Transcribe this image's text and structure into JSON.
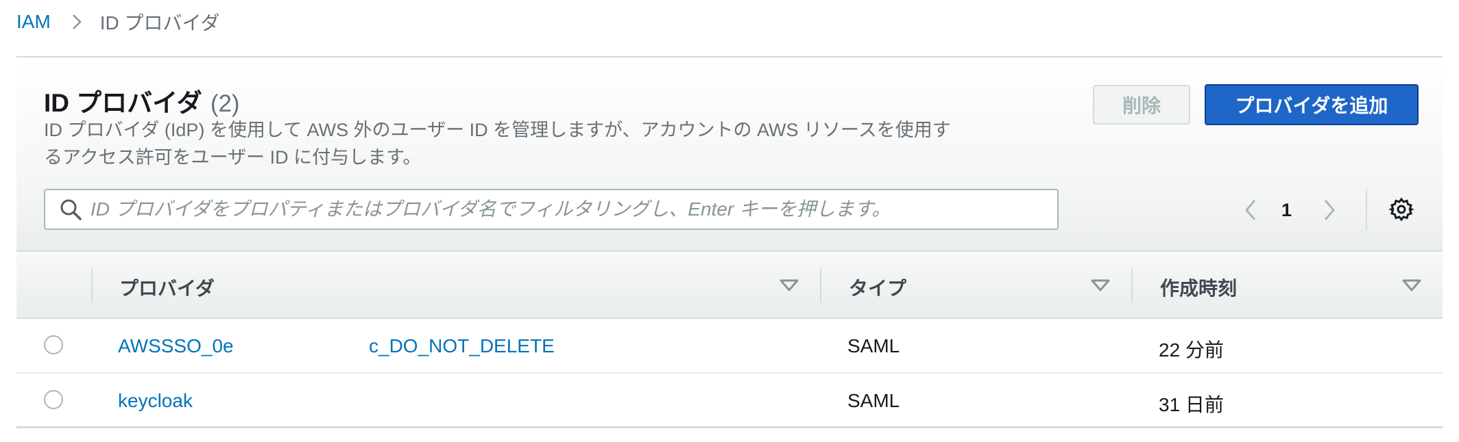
{
  "breadcrumb": {
    "root": "IAM",
    "current": "ID プロバイダ"
  },
  "panel": {
    "title": "ID プロバイダ",
    "count": "(2)",
    "description": "ID プロバイダ (IdP) を使用して AWS 外のユーザー ID を管理しますが、アカウントの AWS リソースを使用するアクセス許可をユーザー ID に付与します。",
    "delete_button": "削除",
    "add_button": "プロバイダを追加"
  },
  "search": {
    "placeholder": "ID プロバイダをプロパティまたはプロバイダ名でフィルタリングし、Enter キーを押します。"
  },
  "pagination": {
    "current_page": "1"
  },
  "table": {
    "columns": [
      "プロバイダ",
      "タイプ",
      "作成時刻"
    ],
    "rows": [
      {
        "provider": "AWSSSO_0e",
        "provider_suffix": "c_DO_NOT_DELETE",
        "type": "SAML",
        "created": "22 分前"
      },
      {
        "provider": "keycloak",
        "provider_suffix": "",
        "type": "SAML",
        "created": "31 日前"
      }
    ]
  },
  "colors": {
    "link": "#0073bb",
    "primary_button": "#1e66c7",
    "muted_text": "#687078"
  },
  "icons": {
    "breadcrumb_separator": "chevron-right-icon",
    "search": "search-icon",
    "prev": "chevron-left-icon",
    "next": "chevron-right-icon",
    "settings": "gear-icon",
    "sort": "caret-down-icon"
  }
}
